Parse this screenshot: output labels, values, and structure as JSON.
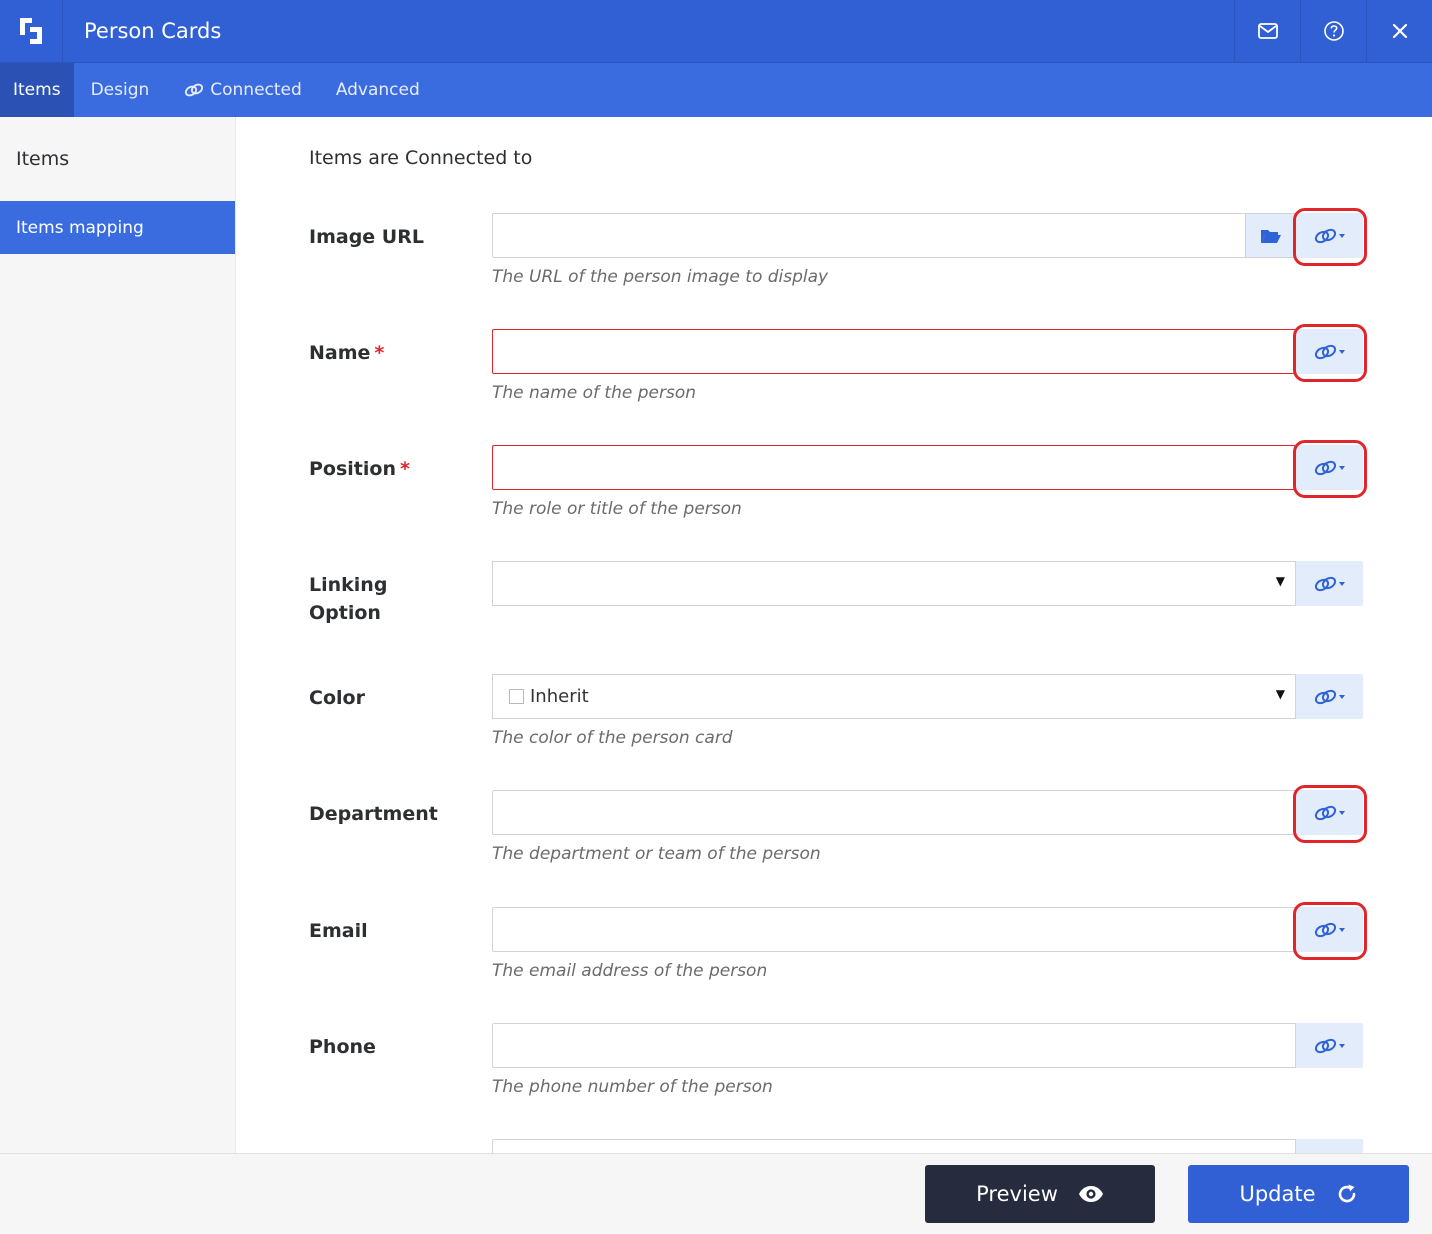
{
  "window": {
    "title": "Person Cards",
    "icons": {
      "logo": "app-logo-icon",
      "mail": "envelope-icon",
      "help": "question-circle-icon",
      "close": "close-icon"
    }
  },
  "tabs": [
    {
      "label": "Items",
      "active": true
    },
    {
      "label": "Design",
      "active": false
    },
    {
      "label": "Connected",
      "active": false,
      "icon": "link-icon"
    },
    {
      "label": "Advanced",
      "active": false
    }
  ],
  "sidebar": {
    "items": [
      {
        "label": "Items",
        "active": false
      },
      {
        "label": "Items mapping",
        "active": true
      }
    ]
  },
  "main": {
    "section_title": "Items are Connected to",
    "fields": [
      {
        "label": "Image URL",
        "required": false,
        "type": "text",
        "value": "",
        "help": "The URL of the person image to display",
        "has_folder": true,
        "highlighted": true
      },
      {
        "label": "Name",
        "required": true,
        "type": "text",
        "value": "",
        "help": "The name of the person",
        "has_folder": false,
        "highlighted": true
      },
      {
        "label": "Position",
        "required": true,
        "type": "text",
        "value": "",
        "help": "The role or title of the person",
        "has_folder": false,
        "highlighted": true
      },
      {
        "label": "Linking Option",
        "required": false,
        "type": "select",
        "value": "",
        "help": "",
        "has_folder": false,
        "highlighted": false
      },
      {
        "label": "Color",
        "required": false,
        "type": "select",
        "value": "Inherit",
        "help": "The color of the person card",
        "has_folder": false,
        "highlighted": false
      },
      {
        "label": "Department",
        "required": false,
        "type": "text",
        "value": "",
        "help": "The department or team of the person",
        "has_folder": false,
        "highlighted": true
      },
      {
        "label": "Email",
        "required": false,
        "type": "text",
        "value": "",
        "help": "The email address of the person",
        "has_folder": false,
        "highlighted": true
      },
      {
        "label": "Phone",
        "required": false,
        "type": "text",
        "value": "",
        "help": "The phone number of the person",
        "has_folder": false,
        "highlighted": false
      }
    ],
    "required_mark": "*"
  },
  "footer": {
    "preview_label": "Preview",
    "update_label": "Update",
    "preview_icon": "eye-icon",
    "update_icon": "refresh-icon"
  },
  "colors": {
    "titlebar": "#3160d4",
    "tabsbar": "#3a6ce0",
    "active_tab": "#2a51b3",
    "error": "#e0262b",
    "link_button_bg": "#e3ecfb",
    "preview_button": "#262b3d"
  }
}
